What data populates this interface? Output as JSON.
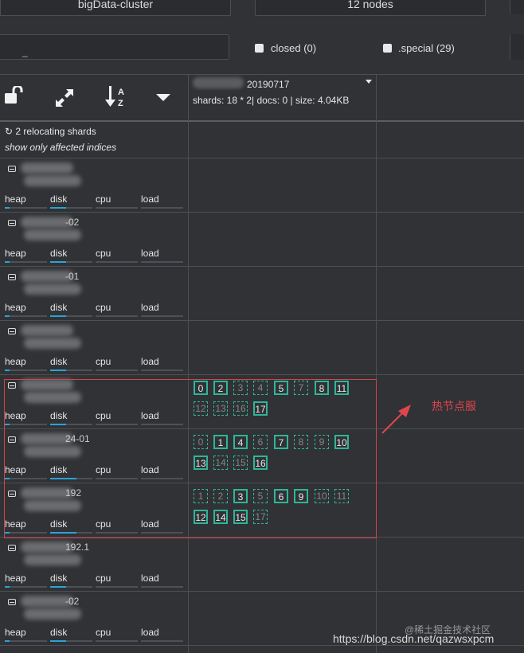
{
  "top": {
    "cluster_name": "bigData-cluster",
    "nodes_count": "12 nodes"
  },
  "filter": {
    "input_value": "_",
    "closed_label": "closed (0)",
    "special_label": ".special (29)"
  },
  "index": {
    "name_suffix": "20190717",
    "stats": "shards: 18 * 2| docs: 0 | size: 4.04KB"
  },
  "relocation": {
    "text": "2 relocating shards",
    "affected_link": "show only affected indices"
  },
  "metrics": {
    "heap": "heap",
    "disk": "disk",
    "cpu": "cpu",
    "load": "load"
  },
  "nodes": [
    {
      "id": "node-1",
      "heap": 0.12,
      "disk": 0.38,
      "shards": []
    },
    {
      "id": "node-2",
      "heap": 0.12,
      "disk": 0.38,
      "shards": [],
      "partial_text": "-02"
    },
    {
      "id": "node-3",
      "heap": 0.12,
      "disk": 0.38,
      "shards": [],
      "partial_text": "-01"
    },
    {
      "id": "node-4",
      "heap": 0.12,
      "disk": 0.38,
      "shards": []
    },
    {
      "id": "node-5",
      "heap": 0.12,
      "disk": 0.38,
      "shards": [
        {
          "n": "0",
          "p": true
        },
        {
          "n": "2",
          "p": true
        },
        {
          "n": "3",
          "p": false
        },
        {
          "n": "4",
          "p": false
        },
        {
          "n": "5",
          "p": true
        },
        {
          "n": "7",
          "p": false
        },
        {
          "n": "8",
          "p": true
        },
        {
          "n": "11",
          "p": true
        },
        {
          "n": "12",
          "p": false
        },
        {
          "n": "13",
          "p": false
        },
        {
          "n": "16",
          "p": false
        },
        {
          "n": "17",
          "p": true
        }
      ]
    },
    {
      "id": "node-6",
      "heap": 0.12,
      "disk": 0.62,
      "partial_text": "24-01",
      "shards": [
        {
          "n": "0",
          "p": false
        },
        {
          "n": "1",
          "p": true
        },
        {
          "n": "4",
          "p": true
        },
        {
          "n": "6",
          "p": false
        },
        {
          "n": "7",
          "p": true
        },
        {
          "n": "8",
          "p": false
        },
        {
          "n": "9",
          "p": false
        },
        {
          "n": "10",
          "p": true
        },
        {
          "n": "13",
          "p": true
        },
        {
          "n": "14",
          "p": false
        },
        {
          "n": "15",
          "p": false
        },
        {
          "n": "16",
          "p": true
        }
      ]
    },
    {
      "id": "node-7",
      "heap": 0.12,
      "disk": 0.62,
      "partial_text": "192",
      "shards": [
        {
          "n": "1",
          "p": false
        },
        {
          "n": "2",
          "p": false
        },
        {
          "n": "3",
          "p": true
        },
        {
          "n": "5",
          "p": false
        },
        {
          "n": "6",
          "p": true
        },
        {
          "n": "9",
          "p": true
        },
        {
          "n": "10",
          "p": false
        },
        {
          "n": "11",
          "p": false
        },
        {
          "n": "12",
          "p": true
        },
        {
          "n": "14",
          "p": true
        },
        {
          "n": "15",
          "p": true
        },
        {
          "n": "17",
          "p": false
        }
      ]
    },
    {
      "id": "node-8",
      "heap": 0.12,
      "disk": 0.38,
      "shards": [],
      "partial_text": "192.1"
    },
    {
      "id": "node-9",
      "heap": 0.12,
      "disk": 0.38,
      "shards": [],
      "partial_text": "-02"
    }
  ],
  "annotation": {
    "label": "热节点服"
  },
  "watermark": {
    "line1": "@稀土掘金技术社区",
    "line2": "https://blog.csdn.net/qazwsxpcm"
  },
  "colors": {
    "accent": "#2fb59a",
    "bar": "#2aa3d8",
    "highlight": "#d9404a"
  }
}
